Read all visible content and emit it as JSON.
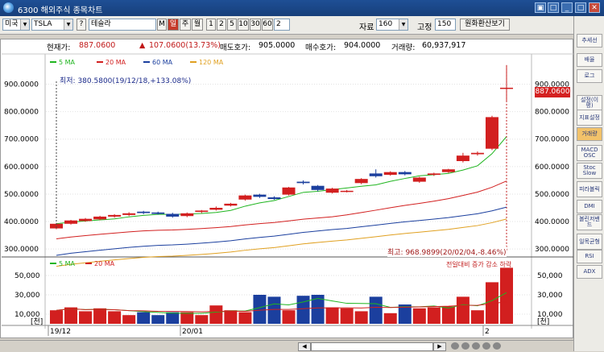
{
  "window": {
    "title": "6300 해외주식 종목차트"
  },
  "toolbar": {
    "market": "미국",
    "ticker": "TSLA",
    "help_q": "?",
    "name": "테슬라",
    "m_label": "M",
    "period_buttons": [
      "일",
      "주",
      "월",
      "1",
      "2",
      "5",
      "10",
      "30",
      "60"
    ],
    "custom_period": "2",
    "data_label": "자료",
    "data_count": "160",
    "fixed_label": "고정",
    "fixed_count": "150",
    "convert_button": "원화환산보기"
  },
  "info": {
    "price_label": "현재가:",
    "price": "887.0600",
    "change_arrow": "▲",
    "change": "107.0600(13.73%)",
    "ask_label": "매도호가:",
    "ask": "905.0000",
    "bid_label": "매수호가:",
    "bid": "904.0000",
    "volume_label": "거래량:",
    "volume": "60,937,917"
  },
  "legend_price": [
    {
      "name": "5 MA",
      "color": "#1fb51f"
    },
    {
      "name": "20 MA",
      "color": "#d21f1f"
    },
    {
      "name": "60 MA",
      "color": "#1b3f9e"
    },
    {
      "name": "120 MA",
      "color": "#e0a020"
    }
  ],
  "annotations": {
    "low": "최저: 380.5800(19/12/18,+133.08%)",
    "high": "최고: 968.9899(20/02/04,-8.46%)",
    "current_price_tag": "887.0600"
  },
  "price_axis": [
    "900.0000",
    "800.0000",
    "700.0000",
    "600.0000",
    "500.0000",
    "400.0000",
    "300.0000"
  ],
  "volume_legend": [
    {
      "name": "5 MA",
      "color": "#1fb51f"
    },
    {
      "name": "20 MA",
      "color": "#d21f1f"
    }
  ],
  "volume_note": "전일대비 증가 감소 하락",
  "volume_axis": [
    "50,000",
    "30,000",
    "10,000"
  ],
  "volume_unit": "[천]",
  "x_axis": [
    "19/12",
    "20/01",
    "2"
  ],
  "sidebar": [
    "추세선",
    "배율",
    "로그",
    "설정(이평)",
    "지표설정",
    "거래량",
    "MACD OSC",
    "Stoc Slow",
    "피라볼릭",
    "DMI",
    "볼린저밴드",
    "일목균형",
    "RSI",
    "ADX"
  ],
  "chart_data": {
    "type": "candlestick",
    "price_ylim": [
      280,
      960
    ],
    "candles": [
      {
        "o": 375,
        "c": 392,
        "h": 395,
        "l": 372
      },
      {
        "o": 392,
        "c": 404,
        "h": 406,
        "l": 389
      },
      {
        "o": 402,
        "c": 410,
        "h": 413,
        "l": 399
      },
      {
        "o": 408,
        "c": 418,
        "h": 421,
        "l": 405
      },
      {
        "o": 418,
        "c": 424,
        "h": 427,
        "l": 414
      },
      {
        "o": 424,
        "c": 430,
        "h": 434,
        "l": 420
      },
      {
        "o": 436,
        "c": 431,
        "h": 439,
        "l": 427
      },
      {
        "o": 433,
        "c": 428,
        "h": 436,
        "l": 425
      },
      {
        "o": 428,
        "c": 418,
        "h": 432,
        "l": 414
      },
      {
        "o": 420,
        "c": 430,
        "h": 433,
        "l": 416
      },
      {
        "o": 435,
        "c": 440,
        "h": 442,
        "l": 431
      },
      {
        "o": 443,
        "c": 450,
        "h": 455,
        "l": 440
      },
      {
        "o": 458,
        "c": 465,
        "h": 468,
        "l": 455
      },
      {
        "o": 480,
        "c": 495,
        "h": 498,
        "l": 476
      },
      {
        "o": 498,
        "c": 490,
        "h": 501,
        "l": 486
      },
      {
        "o": 488,
        "c": 482,
        "h": 492,
        "l": 479
      },
      {
        "o": 498,
        "c": 524,
        "h": 526,
        "l": 495
      },
      {
        "o": 545,
        "c": 540,
        "h": 550,
        "l": 535
      },
      {
        "o": 530,
        "c": 515,
        "h": 533,
        "l": 510
      },
      {
        "o": 505,
        "c": 520,
        "h": 523,
        "l": 502
      },
      {
        "o": 510,
        "c": 512,
        "h": 515,
        "l": 506
      },
      {
        "o": 540,
        "c": 555,
        "h": 558,
        "l": 536
      },
      {
        "o": 575,
        "c": 565,
        "h": 590,
        "l": 560
      },
      {
        "o": 570,
        "c": 580,
        "h": 583,
        "l": 567
      },
      {
        "o": 580,
        "c": 572,
        "h": 584,
        "l": 568
      },
      {
        "o": 545,
        "c": 560,
        "h": 563,
        "l": 541
      },
      {
        "o": 570,
        "c": 575,
        "h": 578,
        "l": 566
      },
      {
        "o": 580,
        "c": 590,
        "h": 592,
        "l": 577
      },
      {
        "o": 620,
        "c": 640,
        "h": 650,
        "l": 615
      },
      {
        "o": 645,
        "c": 650,
        "h": 655,
        "l": 640
      },
      {
        "o": 665,
        "c": 780,
        "h": 785,
        "l": 660
      },
      {
        "o": 887,
        "c": 887,
        "h": 969,
        "l": 840
      }
    ],
    "volumes": [
      14,
      17,
      13,
      16,
      13,
      9,
      12,
      9,
      12,
      12,
      9,
      19,
      14,
      12,
      30,
      28,
      14,
      29,
      30,
      17,
      16,
      13,
      28,
      11,
      20,
      16,
      17,
      18,
      28,
      14,
      43,
      58
    ]
  }
}
